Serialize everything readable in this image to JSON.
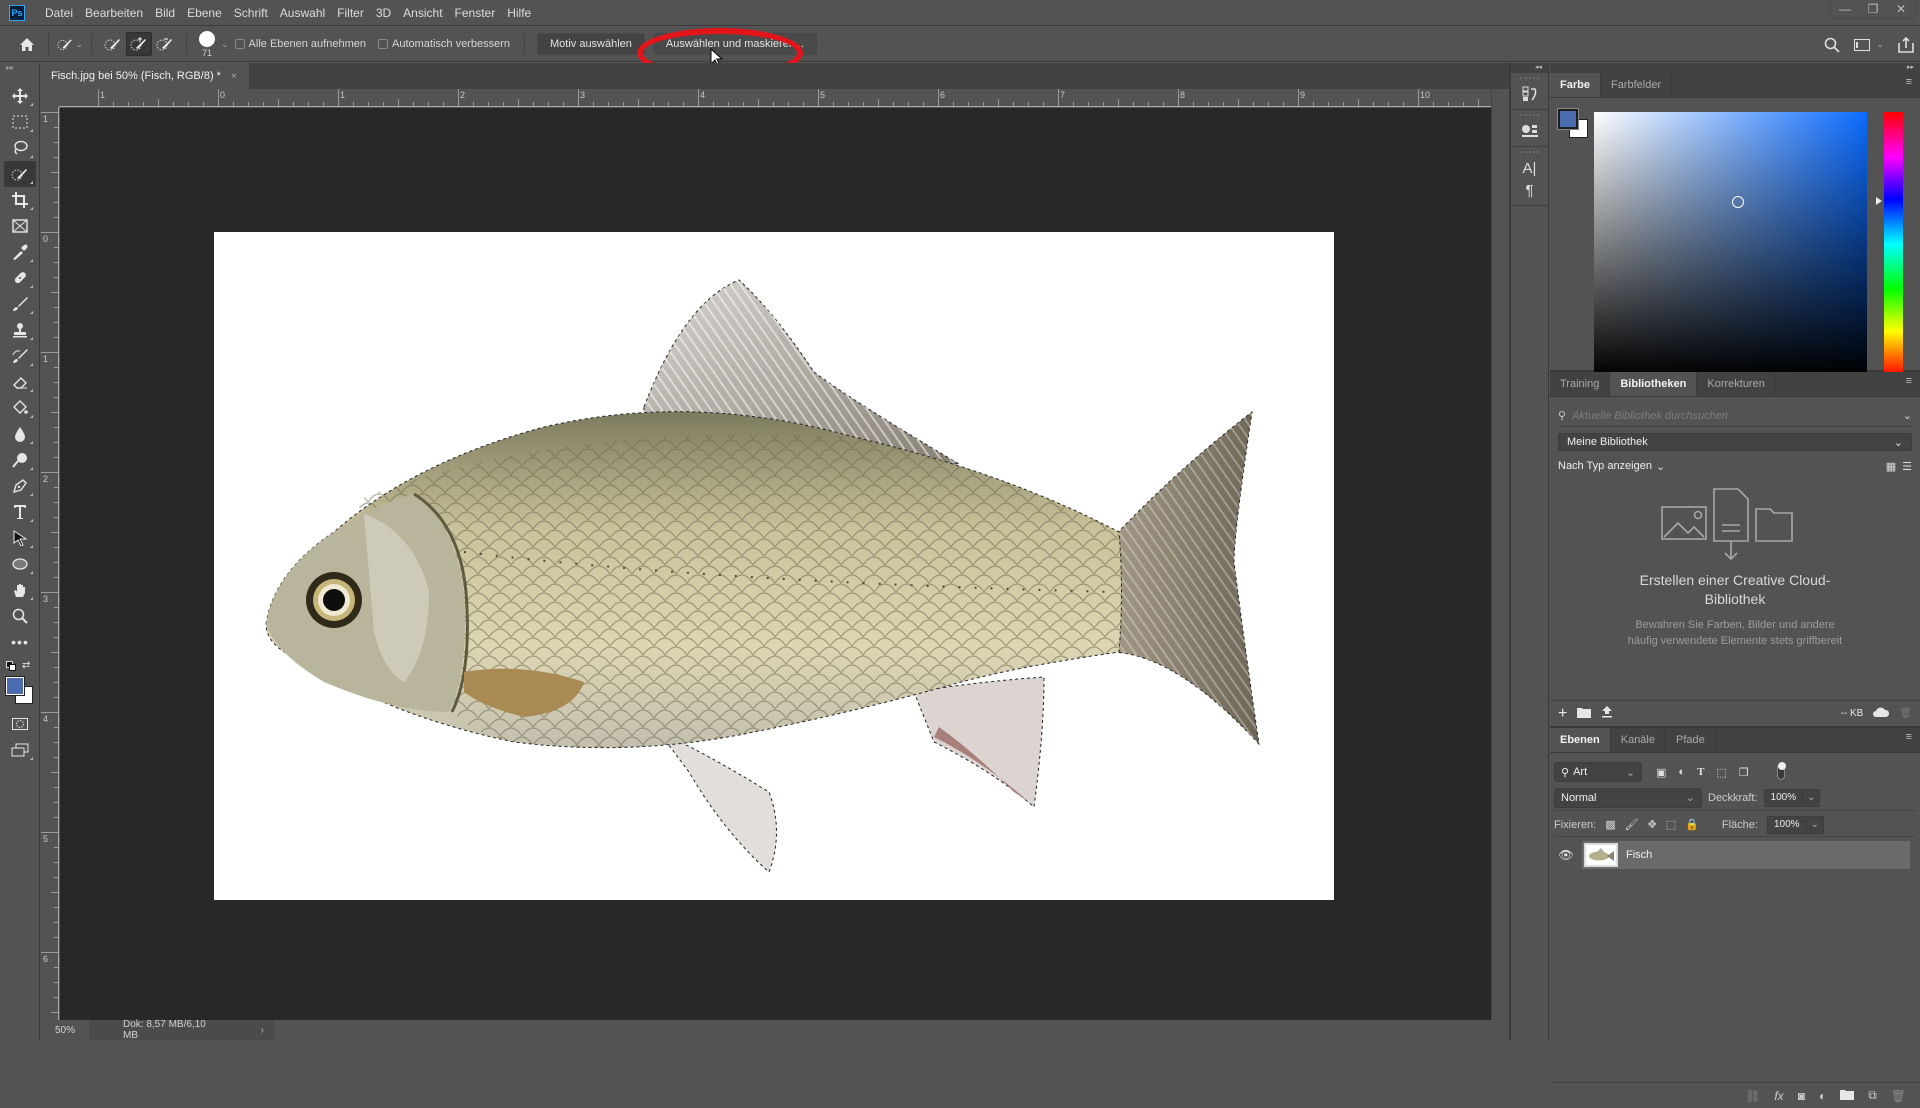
{
  "app": {
    "logo": "Ps"
  },
  "menu": [
    "Datei",
    "Bearbeiten",
    "Bild",
    "Ebene",
    "Schrift",
    "Auswahl",
    "Filter",
    "3D",
    "Ansicht",
    "Fenster",
    "Hilfe"
  ],
  "window_controls": {
    "minimize": "—",
    "restore": "❐",
    "close": "✕"
  },
  "options": {
    "brush_size": "71",
    "sample_all_layers_label": "Alle Ebenen aufnehmen",
    "sample_all_layers_checked": false,
    "auto_enhance_label": "Automatisch verbessern",
    "auto_enhance_checked": false,
    "select_subject_label": "Motiv auswählen",
    "select_and_mask_label": "Auswählen und maskieren..."
  },
  "highlight": {
    "color": "#e3141a",
    "target": "Auswählen und maskieren..."
  },
  "document": {
    "tab_title": "Fisch.jpg bei 50% (Fisch, RGB/8) *",
    "close": "×",
    "zoom": "50%",
    "doc_size": "Dok: 8,57 MB/6,10 MB",
    "status_arrow": "›"
  },
  "rulers": {
    "horizontal": [
      "1",
      "0",
      "1",
      "2",
      "3",
      "4",
      "5",
      "6",
      "7",
      "8",
      "9",
      "10"
    ],
    "vertical": [
      "1",
      "0",
      "1",
      "2",
      "3",
      "4",
      "5",
      "6"
    ]
  },
  "colors": {
    "foreground": "#4b6bb0",
    "background": "#ffffff",
    "picker_hue": "#0b6bff"
  },
  "color_panel": {
    "tabs": [
      "Farbe",
      "Farbfelder"
    ],
    "active_tab": "Farbe"
  },
  "library_panel": {
    "tabs": [
      "Training",
      "Bibliotheken",
      "Korrekturen"
    ],
    "active_tab": "Bibliotheken",
    "search_placeholder": "Aktuelle Bibliothek durchsuchen",
    "library_select": "Meine Bibliothek",
    "view_by": "Nach Typ anzeigen",
    "empty_title_line1": "Erstellen einer Creative Cloud-",
    "empty_title_line2": "Bibliothek",
    "empty_desc_line1": "Bewahren Sie Farben, Bilder und andere",
    "empty_desc_line2": "häufig verwendete Elemente stets griffbereit",
    "storage": "-- KB"
  },
  "layers_panel": {
    "tabs": [
      "Ebenen",
      "Kanäle",
      "Pfade"
    ],
    "active_tab": "Ebenen",
    "filter_kind": "Art",
    "blend_mode": "Normal",
    "opacity_label": "Deckkraft:",
    "opacity": "100%",
    "lock_label": "Fixieren:",
    "fill_label": "Fläche:",
    "fill": "100%",
    "layers": [
      {
        "name": "Fisch",
        "visible": true,
        "selected": true
      }
    ]
  }
}
